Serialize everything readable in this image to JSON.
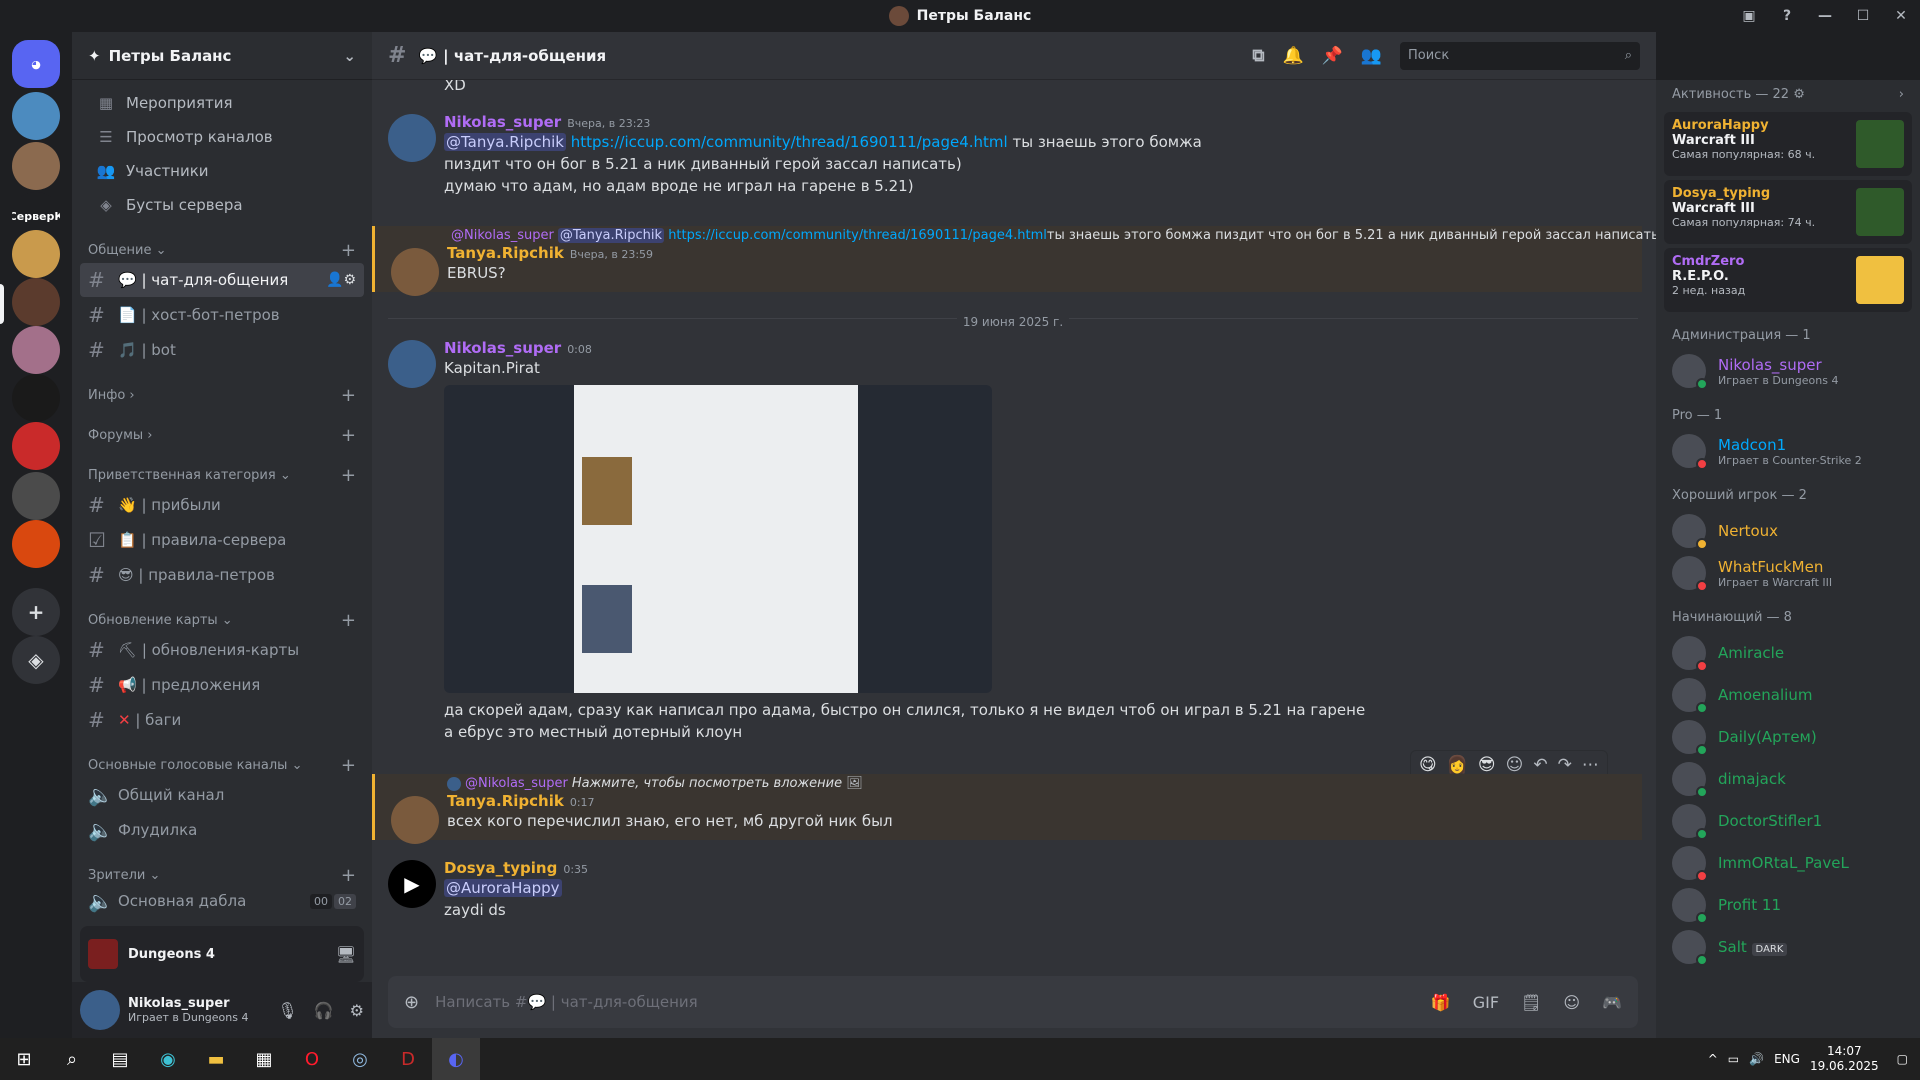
{
  "window": {
    "title": "Петры Баланс"
  },
  "guilds": [
    {
      "label": "",
      "color": "#5865f2",
      "icon": "discord-icon"
    },
    {
      "label": "",
      "color": "#4c8bbf"
    },
    {
      "label": "",
      "color": "#8b6a4f"
    },
    {
      "label": "СерверК",
      "color": "#1e1f22"
    },
    {
      "label": "",
      "color": "#c99a4c"
    },
    {
      "label": "",
      "color": "#5b3b2d"
    },
    {
      "label": "",
      "color": "#a3708a"
    },
    {
      "label": "",
      "color": "#1a1a1a"
    },
    {
      "label": "",
      "color": "#c92a2a"
    },
    {
      "label": "",
      "color": "#4b4b4b"
    },
    {
      "label": "",
      "color": "#d9480f"
    }
  ],
  "server": {
    "name": "Петры Баланс"
  },
  "nav": [
    {
      "label": "Мероприятия",
      "icon": "calendar-icon"
    },
    {
      "label": "Просмотр каналов",
      "icon": "list-icon"
    },
    {
      "label": "Участники",
      "icon": "members-icon"
    },
    {
      "label": "Бусты сервера",
      "icon": "boost-icon"
    }
  ],
  "categories": {
    "c1": "Общение",
    "c2": "Инфо",
    "c3": "Форумы",
    "c4": "Приветственная категория",
    "c5": "Обновление карты",
    "c6": "Основные голосовые каналы",
    "c7": "Зрители"
  },
  "channels": {
    "chat": "| чат-для-общения",
    "host": "| хост-бот-петров",
    "bot": "| bot",
    "arrived": "| прибыли",
    "rules": "| правила-сервера",
    "rules2": "| правила-петров",
    "updates": "| обновления-карты",
    "suggest": "| предложения",
    "bugs": "| баги",
    "voice1": "Общий канал",
    "voice2": "Флудилка",
    "voice3": "Основная дабла",
    "voice3_a": "00",
    "voice3_b": "02"
  },
  "voice_status": {
    "label": "Dungeons 4"
  },
  "user": {
    "name": "Nikolas_super",
    "activity": "Играет в Dungeons 4"
  },
  "header": {
    "channel": "| чат-для-общения",
    "search_placeholder": "Поиск"
  },
  "messages": {
    "top_cut": "XD",
    "m1": {
      "author": "Nikolas_super",
      "time": "Вчера, в 23:23",
      "mention": "@Tanya.Ripchik",
      "link": "https://iccup.com/community/thread/1690111/page4.html",
      "text1": " ты знаешь этого бомжа",
      "text2": "пиздит что он бог в 5.21 а ник диванный герой зассал написать)",
      "text3": "думаю что адам, но адам вроде не играл на гарене в 5.21)"
    },
    "m2": {
      "reply_author": "@Nikolas_super",
      "reply_mention": "@Tanya.Ripchik",
      "reply_link": "https://iccup.com/community/thread/1690111/page4.html",
      "reply_text": " ты знаешь этого бомжа пиздит что он бог в 5.21 а ник диванный герой зассал написать)",
      "author": "Tanya.Ripchik",
      "time": "Вчера, в 23:59",
      "text": "EBRUS?"
    },
    "date_sep": "19 июня 2025 г.",
    "m3": {
      "author": "Nikolas_super",
      "time": "0:08",
      "text": "Kapitan.Pirat",
      "text2": "да скорей адам, сразу как написал про адама, быстро он слился, только я не видел чтоб он играл в 5.21 на гарене",
      "text3": "а ебрус это местный дотерный клоун"
    },
    "m4": {
      "reply_author": "@Nikolas_super",
      "reply_text": "Нажмите, чтобы посмотреть вложение",
      "author": "Tanya.Ripchik",
      "time": "0:17",
      "text": "всех кого перечислил знаю, его нет, мб другой ник был"
    },
    "m5": {
      "author": "Dosya_typing",
      "time": "0:35",
      "mention": "@AuroraHappy",
      "text": "zaydi ds"
    }
  },
  "composer": {
    "placeholder": "Написать #💬 | чат-для-общения"
  },
  "members": {
    "activity_header": "Активность — 22",
    "cards": [
      {
        "user": "AuroraHappy",
        "game": "Warcraft III",
        "sub": "Самая популярная: 68 ч.",
        "color": "#f0b232"
      },
      {
        "user": "Dosya_typing",
        "game": "Warcraft III",
        "sub": "Самая популярная: 74 ч.",
        "color": "#f0b232"
      },
      {
        "user": "CmdrZero",
        "game": "R.E.P.O.",
        "sub": "2 нед. назад",
        "color": "#b06cf5"
      }
    ],
    "groups": [
      {
        "title": "Администрация — 1",
        "items": [
          {
            "name": "Nikolas_super",
            "act": "Играет в Dungeons 4",
            "color": "#b06cf5",
            "status": "#23a55a"
          }
        ]
      },
      {
        "title": "Pro — 1",
        "items": [
          {
            "name": "Madcon1",
            "act": "Играет в Counter-Strike 2",
            "color": "#00a8fc",
            "status": "#f23f43"
          }
        ]
      },
      {
        "title": "Хороший игрок — 2",
        "items": [
          {
            "name": "Nertoux",
            "act": "",
            "color": "#f0b232",
            "status": "#f0b232"
          },
          {
            "name": "WhatFuckMen",
            "act": "Играет в Warcraft III",
            "color": "#f0b232",
            "status": "#f23f43"
          }
        ]
      },
      {
        "title": "Начинающий — 8",
        "items": [
          {
            "name": "Amiracle",
            "act": "",
            "color": "#23a55a",
            "status": "#f23f43"
          },
          {
            "name": "Amoenalium",
            "act": "",
            "color": "#23a55a",
            "status": "#23a55a"
          },
          {
            "name": "Daily(Артем)",
            "act": "",
            "color": "#23a55a",
            "status": "#23a55a"
          },
          {
            "name": "dimajack",
            "act": "",
            "color": "#23a55a",
            "status": "#23a55a"
          },
          {
            "name": "DoctorStifler1",
            "act": "",
            "color": "#23a55a",
            "status": "#23a55a"
          },
          {
            "name": "ImmORtaL_PaveL",
            "act": "",
            "color": "#23a55a",
            "status": "#f23f43"
          },
          {
            "name": "Profit 11",
            "act": "",
            "color": "#23a55a",
            "status": "#23a55a"
          },
          {
            "name": "Salt",
            "act": "",
            "color": "#23a55a",
            "status": "#23a55a",
            "badge": "DARK"
          }
        ]
      }
    ]
  },
  "tray": {
    "lang": "ENG",
    "time": "14:07",
    "date": "19.06.2025"
  }
}
